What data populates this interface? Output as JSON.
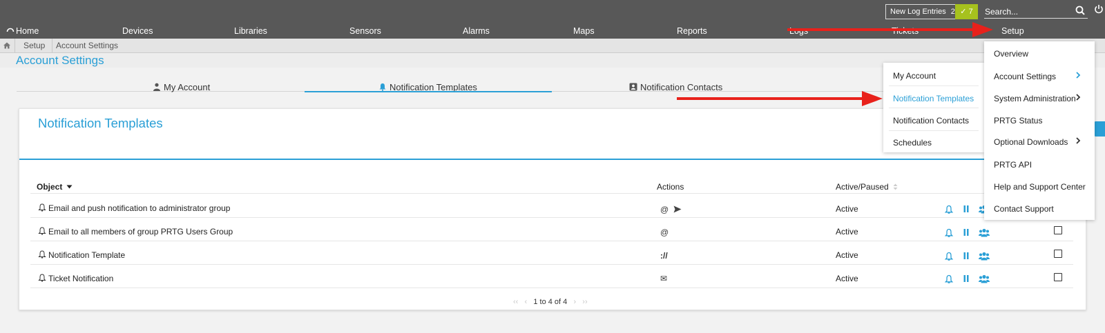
{
  "topbar": {
    "new_log_label": "New Log Entries",
    "new_log_count": "2",
    "ok_count": "7",
    "search_placeholder": "Search..."
  },
  "nav": {
    "items": [
      "Home",
      "Devices",
      "Libraries",
      "Sensors",
      "Alarms",
      "Maps",
      "Reports",
      "Logs",
      "Tickets",
      "Setup"
    ]
  },
  "breadcrumb": [
    "Setup",
    "Account Settings"
  ],
  "page_title": "Account Settings",
  "tabs": [
    "My Account",
    "Notification Templates",
    "Notification Contacts"
  ],
  "card": {
    "title": "Notification Templates",
    "columns": {
      "object": "Object",
      "actions": "Actions",
      "active": "Active/Paused"
    },
    "rows": [
      {
        "name": "Email and push notification to administrator group",
        "actions": "@",
        "status": "Active"
      },
      {
        "name": "Email to all members of group PRTG Users Group",
        "actions": "@",
        "status": "Active"
      },
      {
        "name": "Notification Template",
        "actions": "://",
        "status": "Active"
      },
      {
        "name": "Ticket Notification",
        "actions": "✉",
        "status": "Active"
      }
    ],
    "pager": "1 to 4 of 4"
  },
  "submenu": [
    "My Account",
    "Notification Templates",
    "Notification Contacts",
    "Schedules"
  ],
  "mainmenu": [
    "Overview",
    "Account Settings",
    "System Administration",
    "PRTG Status",
    "Optional Downloads",
    "PRTG API",
    "Help and Support Center",
    "Contact Support"
  ],
  "colors": {
    "accent": "#2a9fd6",
    "topbar": "#585858",
    "ok_badge": "#a6c11e",
    "arrow": "#e8211b"
  },
  "icons": [
    "home-icon",
    "search-icon",
    "power-icon",
    "user-icon",
    "bell-icon",
    "contact-card-icon",
    "pause-icon",
    "users-icon",
    "send-icon",
    "chevron-right-icon"
  ]
}
